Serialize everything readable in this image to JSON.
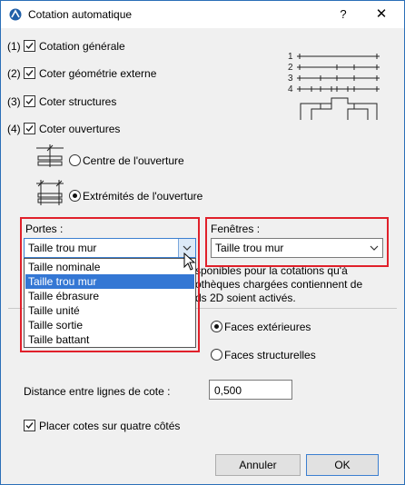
{
  "window": {
    "title": "Cotation automatique",
    "help": "?",
    "close": "✕"
  },
  "options": [
    {
      "num": "(1)",
      "label": "Cotation générale",
      "checked": true
    },
    {
      "num": "(2)",
      "label": "Coter géométrie externe",
      "checked": true
    },
    {
      "num": "(3)",
      "label": "Coter structures",
      "checked": true
    },
    {
      "num": "(4)",
      "label": "Coter ouvertures",
      "checked": true
    }
  ],
  "diagram": {
    "labels": [
      "1",
      "2",
      "3",
      "4"
    ]
  },
  "openings": {
    "center_label": "Centre de l'ouverture",
    "ends_label": "Extrémités de l'ouverture",
    "selected": "ends"
  },
  "doors": {
    "label": "Portes :",
    "selected": "Taille trou mur",
    "options": [
      "Taille nominale",
      "Taille trou mur",
      "Taille ébrasure",
      "Taille unité",
      "Taille sortie",
      "Taille battant"
    ]
  },
  "windows": {
    "label": "Fenêtres :",
    "selected": "Taille trou mur"
  },
  "note": {
    "line1": "sponibles pour la cotations qu'à",
    "line2": "othèques chargées contiennent de",
    "line3": "ds 2D soient activés."
  },
  "faces": {
    "exterior": "Faces extérieures",
    "structural": "Faces structurelles",
    "selected": "exterior"
  },
  "distance": {
    "label": "Distance entre lignes de cote :",
    "value": "0,500"
  },
  "four_sides": {
    "label": "Placer cotes sur quatre côtés",
    "checked": true
  },
  "buttons": {
    "cancel": "Annuler",
    "ok": "OK"
  }
}
